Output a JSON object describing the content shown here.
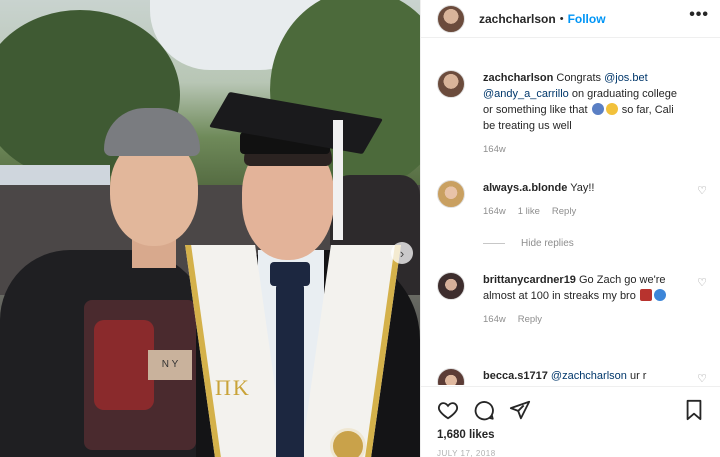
{
  "post": {
    "username": "zachcharlson",
    "follow_label": "Follow",
    "separator": "•",
    "more_label": "•••"
  },
  "photo": {
    "shirt_tag": "N Y",
    "stole_letters": "ΠΚ",
    "next_label": "›"
  },
  "caption": {
    "username": "zachcharlson",
    "text_1": "Congrats",
    "mention_1": "@jos.bet",
    "mention_2": "@andy_a_carrillo",
    "text_2": "on graduating college or something like that",
    "text_3": "so far, Cali be treating us well",
    "time": "164w"
  },
  "comments": [
    {
      "username": "always.a.blonde",
      "text": "Yay!!",
      "time": "164w",
      "likes": "1 like",
      "reply_label": "Reply"
    },
    {
      "username": "brittanycardner19",
      "text": "Go Zach go we're almost at 100 in streaks my bro",
      "time": "164w",
      "reply_label": "Reply"
    },
    {
      "username": "becca.s1717",
      "mention": "@zachcharlson",
      "text": "ur r"
    }
  ],
  "hide_replies_label": "Hide replies",
  "likes_label": "1,680 likes",
  "date_label": "JULY 17, 2018",
  "icons": {
    "like": "heart-icon",
    "comment": "comment-icon",
    "share": "share-icon",
    "save": "bookmark-icon",
    "more": "more-icon"
  },
  "colors": {
    "link": "#0095f6",
    "mention": "#00376b",
    "muted": "#8e8e8e"
  }
}
